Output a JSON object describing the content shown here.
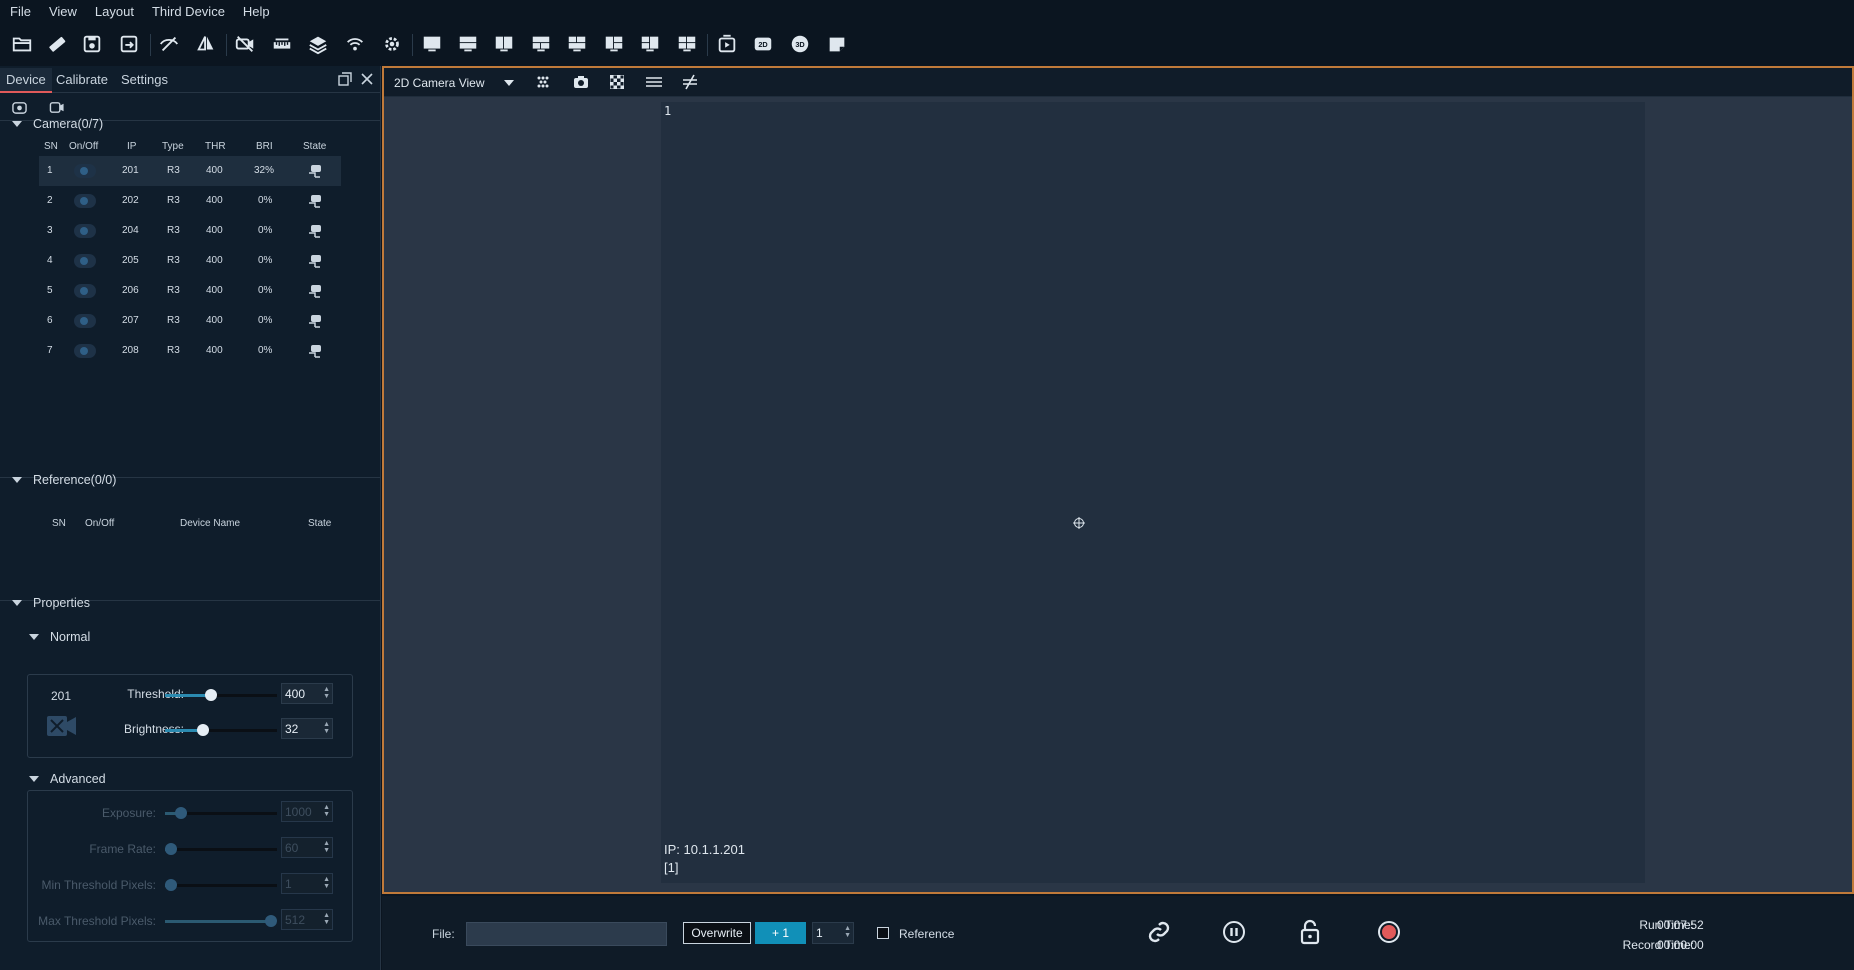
{
  "menu": [
    "File",
    "View",
    "Layout",
    "Third Device",
    "Help"
  ],
  "toolbar_icons": [
    "open-folder-icon",
    "ruler-icon",
    "save-icon",
    "save-as-icon",
    "hide-icon",
    "mirror-icon",
    "camera-off-icon",
    "calibration-ruler-icon",
    "layers-icon",
    "wireless-icon",
    "settings-icon",
    "layout-single-icon",
    "layout-two-rows-icon",
    "layout-two-cols-icon",
    "layout-three-a-icon",
    "layout-three-b-icon",
    "layout-three-c-icon",
    "layout-three-d-icon",
    "layout-four-icon",
    "playback-icon",
    "view-2d-icon",
    "view-3d-icon",
    "note-icon"
  ],
  "left": {
    "tabs": [
      "Device",
      "Calibrate",
      "Settings"
    ],
    "camera_section": "Camera(0/7)",
    "camera_headers": [
      "SN",
      "On/Off",
      "IP",
      "Type",
      "THR",
      "BRI",
      "State"
    ],
    "cameras": [
      {
        "sn": "1",
        "ip": "201",
        "type": "R3",
        "thr": "400",
        "bri": "32%"
      },
      {
        "sn": "2",
        "ip": "202",
        "type": "R3",
        "thr": "400",
        "bri": "0%"
      },
      {
        "sn": "3",
        "ip": "204",
        "type": "R3",
        "thr": "400",
        "bri": "0%"
      },
      {
        "sn": "4",
        "ip": "205",
        "type": "R3",
        "thr": "400",
        "bri": "0%"
      },
      {
        "sn": "5",
        "ip": "206",
        "type": "R3",
        "thr": "400",
        "bri": "0%"
      },
      {
        "sn": "6",
        "ip": "207",
        "type": "R3",
        "thr": "400",
        "bri": "0%"
      },
      {
        "sn": "7",
        "ip": "208",
        "type": "R3",
        "thr": "400",
        "bri": "0%"
      }
    ],
    "reference_section": "Reference(0/0)",
    "reference_headers": [
      "SN",
      "On/Off",
      "Device Name",
      "State"
    ],
    "properties_section": "Properties",
    "normal_section": "Normal",
    "normal": {
      "camera_id": "201",
      "threshold_label": "Threshold:",
      "threshold_value": "400",
      "threshold_fraction": 0.4,
      "brightness_label": "Brightness:",
      "brightness_value": "32",
      "brightness_fraction": 0.32
    },
    "advanced_section": "Advanced",
    "advanced": {
      "exposure_label": "Exposure:",
      "exposure_value": "1000",
      "exposure_fraction": 0.1,
      "frame_rate_label": "Frame Rate:",
      "frame_rate_value": "60",
      "frame_rate_fraction": 0.0,
      "min_threshold_label": "Min Threshold Pixels:",
      "min_threshold_value": "1",
      "min_threshold_fraction": 0.0,
      "max_threshold_label": "Max Threshold Pixels:",
      "max_threshold_value": "512",
      "max_threshold_fraction": 1.0
    }
  },
  "view": {
    "mode_label": "2D Camera View",
    "camera_number": "1",
    "ip_text": "IP: 10.1.1.201",
    "index_text": "[1]"
  },
  "bottom": {
    "file_label": "File:",
    "file_value": "",
    "overwrite_label": "Overwrite",
    "plus_label": "+ 1",
    "counter_value": "1",
    "reference_label": "Reference",
    "run_time_label": "Run Time:",
    "run_time_value": "00:07:52",
    "record_time_label": "Record Time:",
    "record_time_value": "00:00:00"
  },
  "colors": {
    "accent_border": "#c07a3a",
    "slider_fill": "#2b8ab0",
    "plus_button": "#1190b8",
    "record_red": "#e05a5a"
  }
}
